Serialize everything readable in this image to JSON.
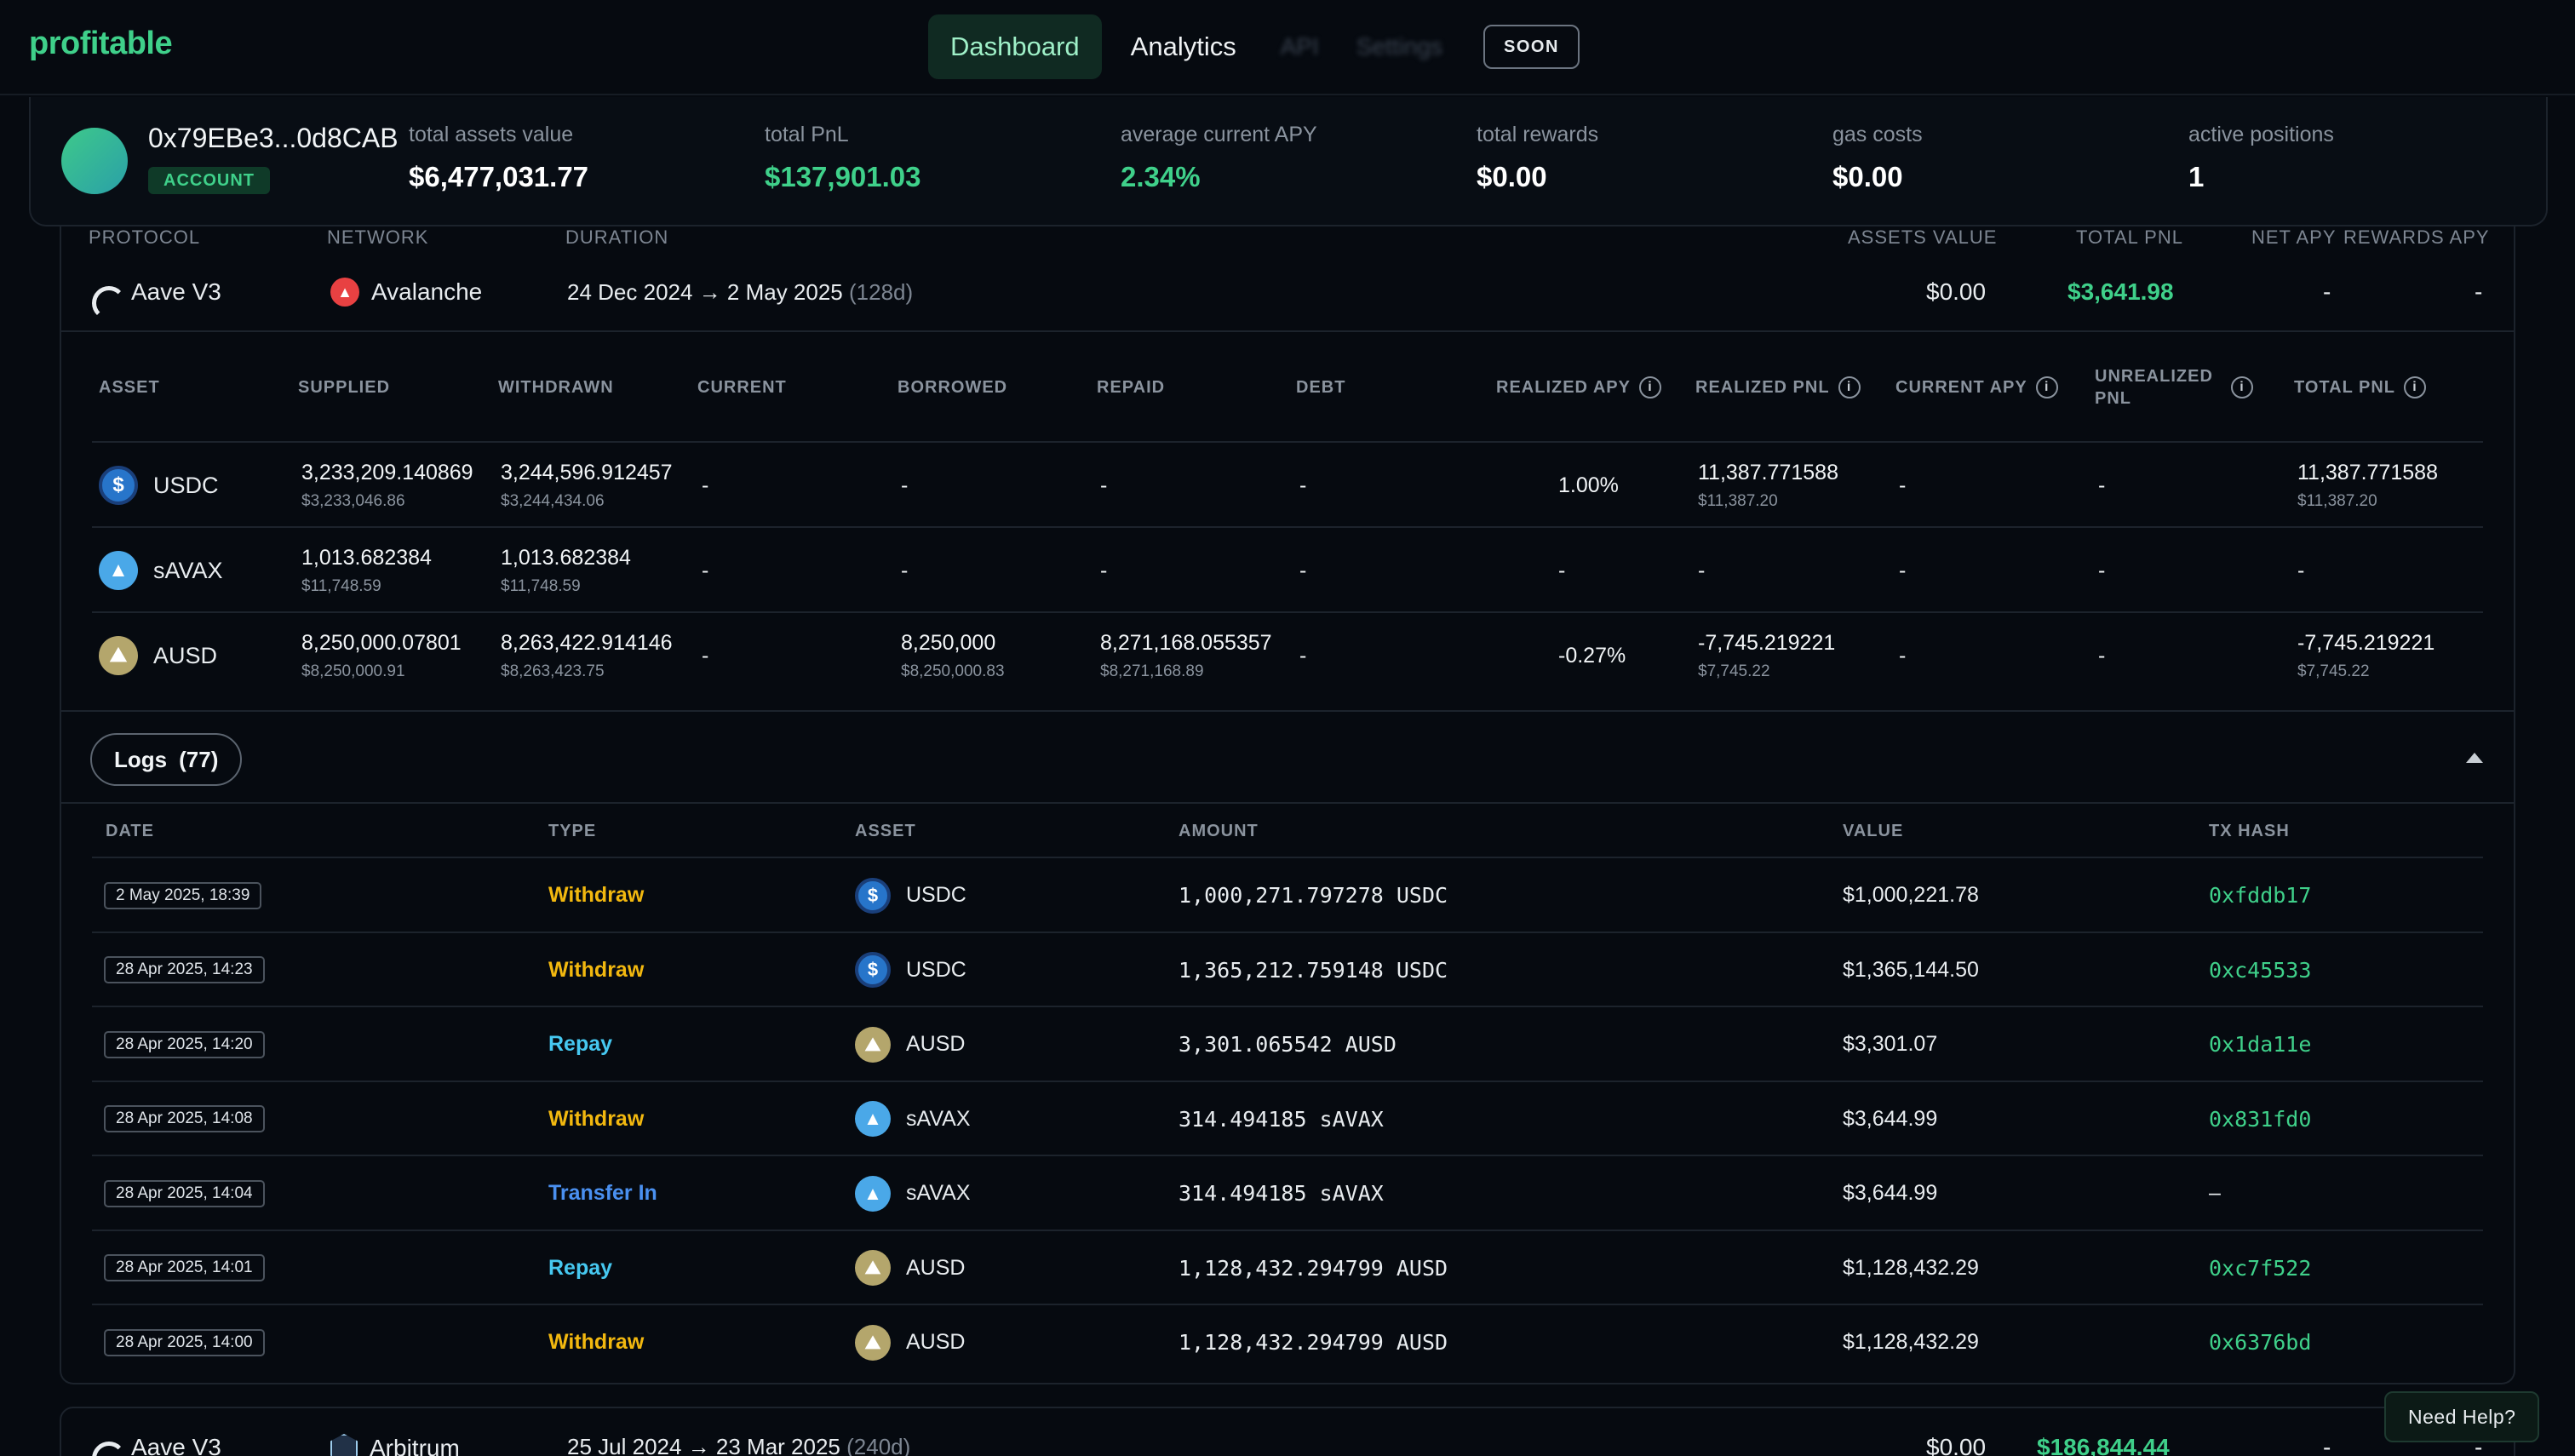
{
  "brand": "profitable",
  "nav": {
    "tabs": [
      "Dashboard",
      "Analytics",
      "API",
      "Settings"
    ],
    "soon": "SOON"
  },
  "account": {
    "address": "0x79EBe3...0d8CAB",
    "badge": "ACCOUNT",
    "stats": [
      {
        "label": "total assets value",
        "value": "$6,477,031.77"
      },
      {
        "label": "total PnL",
        "value": "$137,901.03"
      },
      {
        "label": "average current APY",
        "value": "2.34%"
      },
      {
        "label": "total rewards",
        "value": "$0.00"
      },
      {
        "label": "gas costs",
        "value": "$0.00"
      },
      {
        "label": "active positions",
        "value": "1"
      }
    ]
  },
  "position_header": {
    "protocol": "PROTOCOL",
    "network": "NETWORK",
    "duration": "DURATION",
    "assets_value": "ASSETS VALUE",
    "total_pnl": "TOTAL PNL",
    "net_apy": "NET APY",
    "rewards_apy": "REWARDS APY"
  },
  "position": {
    "protocol": "Aave V3",
    "network": "Avalanche",
    "duration": "24 Dec 2024 → 2 May 2025",
    "duration_days": "(128d)",
    "assets_value": "$0.00",
    "total_pnl": "$3,641.98",
    "net_apy": "-",
    "rewards_apy": "-"
  },
  "asset_columns": [
    "ASSET",
    "SUPPLIED",
    "WITHDRAWN",
    "CURRENT",
    "BORROWED",
    "REPAID",
    "DEBT",
    "REALIZED APY",
    "REALIZED PNL",
    "CURRENT APY",
    "UNREALIZED PNL",
    "TOTAL PNL"
  ],
  "assets": [
    {
      "name": "USDC",
      "supplied": "3,233,209.140869",
      "supplied_usd": "$3,233,046.86",
      "withdrawn": "3,244,596.912457",
      "withdrawn_usd": "$3,244,434.06",
      "current": "-",
      "borrowed": "-",
      "borrowed_usd": "",
      "repaid": "-",
      "repaid_usd": "",
      "debt": "-",
      "realized_apy": "1.00%",
      "realized_pnl": "11,387.771588",
      "realized_pnl_usd": "$11,387.20",
      "current_apy": "-",
      "unrealized_pnl": "-",
      "total_pnl": "11,387.771588",
      "total_pnl_usd": "$11,387.20"
    },
    {
      "name": "sAVAX",
      "supplied": "1,013.682384",
      "supplied_usd": "$11,748.59",
      "withdrawn": "1,013.682384",
      "withdrawn_usd": "$11,748.59",
      "current": "-",
      "borrowed": "-",
      "borrowed_usd": "",
      "repaid": "-",
      "repaid_usd": "",
      "debt": "-",
      "realized_apy": "-",
      "realized_pnl": "-",
      "realized_pnl_usd": "",
      "current_apy": "-",
      "unrealized_pnl": "-",
      "total_pnl": "-",
      "total_pnl_usd": ""
    },
    {
      "name": "AUSD",
      "supplied": "8,250,000.07801",
      "supplied_usd": "$8,250,000.91",
      "withdrawn": "8,263,422.914146",
      "withdrawn_usd": "$8,263,423.75",
      "current": "-",
      "borrowed": "8,250,000",
      "borrowed_usd": "$8,250,000.83",
      "repaid": "8,271,168.055357",
      "repaid_usd": "$8,271,168.89",
      "debt": "-",
      "realized_apy": "-0.27%",
      "realized_pnl": "-7,745.219221",
      "realized_pnl_usd": "$7,745.22",
      "current_apy": "-",
      "unrealized_pnl": "-",
      "total_pnl": "-7,745.219221",
      "total_pnl_usd": "$7,745.22"
    }
  ],
  "logs": {
    "label": "Logs",
    "count": "(77)",
    "columns": [
      "DATE",
      "TYPE",
      "ASSET",
      "AMOUNT",
      "VALUE",
      "TX HASH"
    ],
    "rows": [
      {
        "date": "2 May 2025, 18:39",
        "type": "Withdraw",
        "asset": "USDC",
        "amount": "1,000,271.797278 USDC",
        "value": "$1,000,221.78",
        "tx": "0xfddb17"
      },
      {
        "date": "28 Apr 2025, 14:23",
        "type": "Withdraw",
        "asset": "USDC",
        "amount": "1,365,212.759148 USDC",
        "value": "$1,365,144.50",
        "tx": "0xc45533"
      },
      {
        "date": "28 Apr 2025, 14:20",
        "type": "Repay",
        "asset": "AUSD",
        "amount": "3,301.065542 AUSD",
        "value": "$3,301.07",
        "tx": "0x1da11e"
      },
      {
        "date": "28 Apr 2025, 14:08",
        "type": "Withdraw",
        "asset": "sAVAX",
        "amount": "314.494185 sAVAX",
        "value": "$3,644.99",
        "tx": "0x831fd0"
      },
      {
        "date": "28 Apr 2025, 14:04",
        "type": "Transfer In",
        "asset": "sAVAX",
        "amount": "314.494185 sAVAX",
        "value": "$3,644.99",
        "tx": "–"
      },
      {
        "date": "28 Apr 2025, 14:01",
        "type": "Repay",
        "asset": "AUSD",
        "amount": "1,128,432.294799 AUSD",
        "value": "$1,128,432.29",
        "tx": "0xc7f522"
      },
      {
        "date": "28 Apr 2025, 14:00",
        "type": "Withdraw",
        "asset": "AUSD",
        "amount": "1,128,432.294799 AUSD",
        "value": "$1,128,432.29",
        "tx": "0x6376bd"
      }
    ]
  },
  "position2": {
    "protocol": "Aave V3",
    "network": "Arbitrum",
    "duration": "25 Jul 2024 → 23 Mar 2025",
    "duration_days": "(240d)",
    "assets_value": "$0.00",
    "total_pnl": "$186,844.44",
    "net_apy": "-",
    "rewards_apy": "-"
  },
  "help": "Need Help?",
  "colors": {
    "accent": "#3fd08a",
    "negative": "#ef5d63",
    "withdraw": "#f2b80f",
    "repay": "#46c8f0",
    "transfer": "#4a90f0"
  }
}
